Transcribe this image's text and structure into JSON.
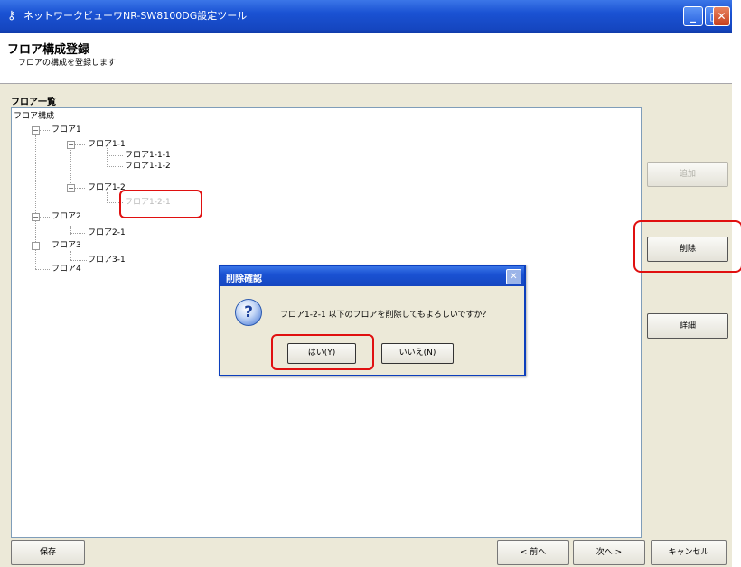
{
  "window": {
    "title": "ネットワークビューワNR-SW8100DG設定ツール",
    "app_icon": "key-icon",
    "controls": {
      "minimize": "_",
      "maximize": "□",
      "close": "✕"
    }
  },
  "header": {
    "title": "フロア構成登録",
    "subtitle": "フロアの構成を登録します"
  },
  "floor_list": {
    "label": "フロア一覧",
    "tree": {
      "root": "フロア構成",
      "floor1": "フロア1",
      "floor1_1": "フロア1-1",
      "floor1_1_1": "フロア1-1-1",
      "floor1_1_2": "フロア1-1-2",
      "floor1_2": "フロア1-2",
      "floor1_2_1": "フロア1-2-1",
      "floor2": "フロア2",
      "floor2_1": "フロア2-1",
      "floor3": "フロア3",
      "floor3_1": "フロア3-1",
      "floor4": "フロア4"
    },
    "expander_collapse": "−"
  },
  "side_buttons": {
    "add": "追加",
    "delete": "削除",
    "detail": "詳細"
  },
  "bottom_buttons": {
    "save": "保存",
    "back": "< 前へ",
    "next": "次へ >",
    "cancel": "キャンセル"
  },
  "dialog": {
    "title": "削除確認",
    "close": "✕",
    "icon": "question-icon",
    "icon_glyph": "?",
    "message": "フロア1-2-1 以下のフロアを削除してもよろしいですか？",
    "yes": "はい(Y)",
    "no": "いいえ(N)"
  },
  "colors": {
    "titlebar": "#1a52d3",
    "highlight_box": "#e01010"
  }
}
